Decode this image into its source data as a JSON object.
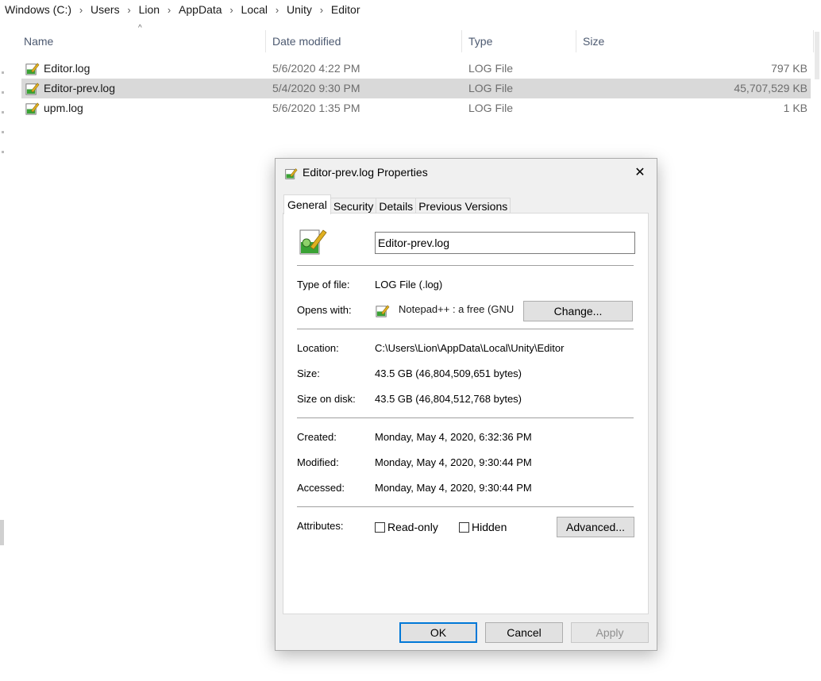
{
  "breadcrumb": [
    "Windows (C:)",
    "Users",
    "Lion",
    "AppData",
    "Local",
    "Unity",
    "Editor"
  ],
  "columns": {
    "name": "Name",
    "date": "Date modified",
    "type": "Type",
    "size": "Size"
  },
  "files": [
    {
      "name": "Editor.log",
      "date": "5/6/2020 4:22 PM",
      "type": "LOG File",
      "size": "797 KB",
      "selected": false
    },
    {
      "name": "Editor-prev.log",
      "date": "5/4/2020 9:30 PM",
      "type": "LOG File",
      "size": "45,707,529 KB",
      "selected": true
    },
    {
      "name": "upm.log",
      "date": "5/6/2020 1:35 PM",
      "type": "LOG File",
      "size": "1 KB",
      "selected": false
    }
  ],
  "dialog": {
    "title": "Editor-prev.log Properties",
    "close_glyph": "✕",
    "tabs": [
      "General",
      "Security",
      "Details",
      "Previous Versions"
    ],
    "active_tab": "General",
    "file_name": "Editor-prev.log",
    "labels": {
      "type": "Type of file:",
      "opens": "Opens with:",
      "location": "Location:",
      "size": "Size:",
      "size_on_disk": "Size on disk:",
      "created": "Created:",
      "modified": "Modified:",
      "accessed": "Accessed:",
      "attributes": "Attributes:"
    },
    "values": {
      "type": "LOG File (.log)",
      "opens": "Notepad++ : a free (GNU",
      "location": "C:\\Users\\Lion\\AppData\\Local\\Unity\\Editor",
      "size": "43.5 GB (46,804,509,651 bytes)",
      "size_on_disk": "43.5 GB (46,804,512,768 bytes)",
      "created": "Monday, May 4, 2020, 6:32:36 PM",
      "modified": "Monday, May 4, 2020, 9:30:44 PM",
      "accessed": "Monday, May 4, 2020, 9:30:44 PM"
    },
    "change_button": "Change...",
    "readonly_label": "Read-only",
    "hidden_label": "Hidden",
    "readonly_checked": false,
    "hidden_checked": false,
    "advanced_button": "Advanced...",
    "ok_button": "OK",
    "cancel_button": "Cancel",
    "apply_button": "Apply"
  },
  "colors": {
    "selection": "#d9d9d9",
    "accent": "#0078d7",
    "icon_green": "#3aa235"
  }
}
